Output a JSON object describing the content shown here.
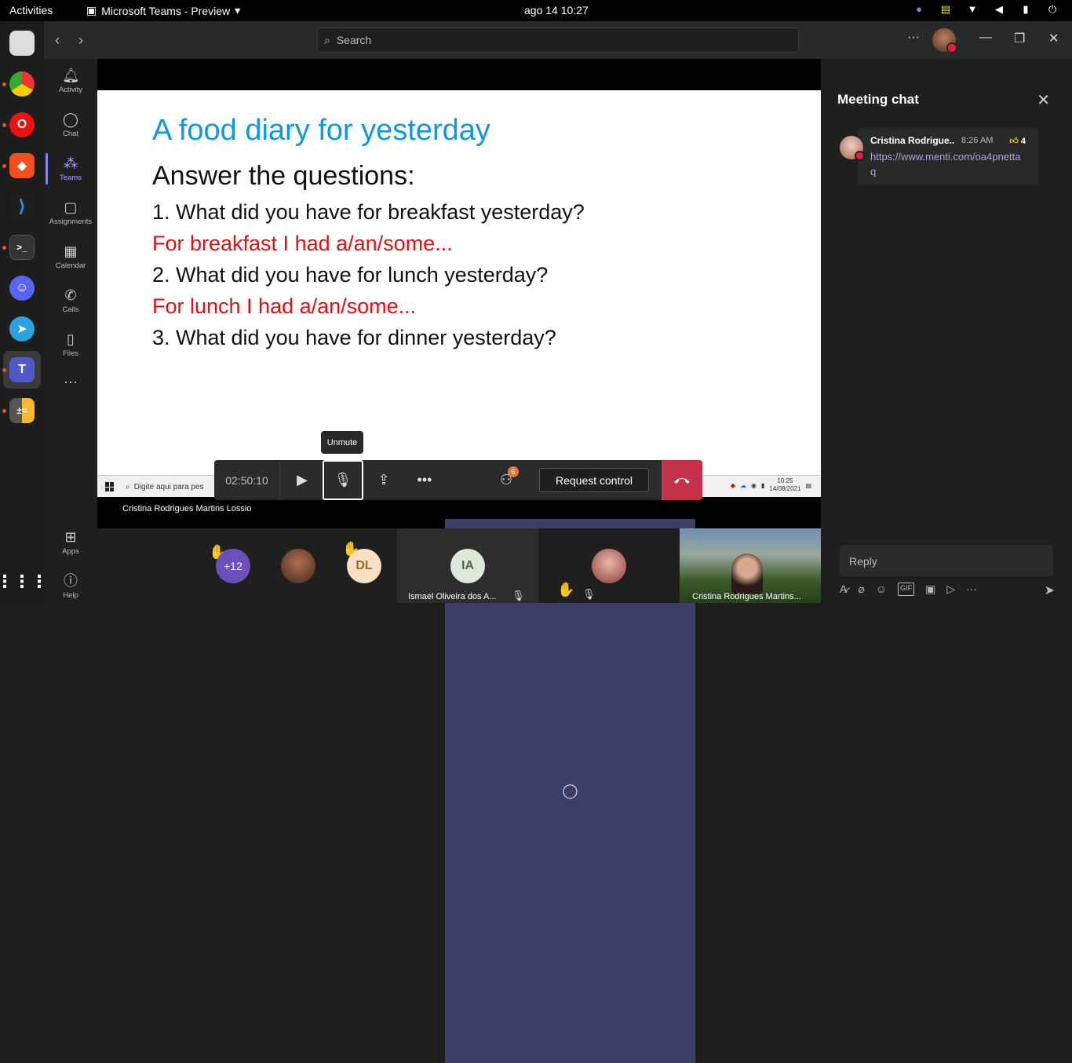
{
  "topbar": {
    "activities": "Activities",
    "app_name": "Microsoft Teams - Preview",
    "clock": "ago 14  10:27"
  },
  "teams": {
    "search_placeholder": "Search",
    "rail": [
      {
        "label": "Activity",
        "icon": "bell-icon"
      },
      {
        "label": "Chat",
        "icon": "chat-icon"
      },
      {
        "label": "Teams",
        "icon": "teams-icon"
      },
      {
        "label": "Assignments",
        "icon": "assignments-icon"
      },
      {
        "label": "Calendar",
        "icon": "calendar-icon"
      },
      {
        "label": "Calls",
        "icon": "phone-icon"
      },
      {
        "label": "Files",
        "icon": "file-icon"
      }
    ],
    "apps_label": "Apps",
    "help_label": "Help"
  },
  "slide": {
    "title": "A food diary for yesterday",
    "heading": "Answer the questions:",
    "q1": "1. What did you have for breakfast yesterday?",
    "a1": "For breakfast I had a/an/some...",
    "q2": "2. What did you have for lunch yesterday?",
    "a2": "For lunch I had a/an/some...",
    "q3": "3. What did you have for dinner yesterday?",
    "taskbar_search": "Digite aqui para pes",
    "taskbar_time": "10:25",
    "taskbar_date": "14/08/2021"
  },
  "presenter": "Cristina Rodrigues Martins Lossio",
  "controls": {
    "timer": "02:50:10",
    "tooltip": "Unmute",
    "participants_badge": "6",
    "request_control": "Request control"
  },
  "participants": {
    "overflow": "+12",
    "dl_initials": "DL",
    "ia_initials": "IA",
    "ia_name": "Ismael Oliveira dos A...",
    "cristina_name": "Cristina Rodrigues Martins..."
  },
  "chat": {
    "title": "Meeting chat",
    "message": {
      "author": "Cristina Rodrigue...",
      "time": "8:26 AM",
      "reaction_count": "4",
      "link": "https://www.menti.com/oa4pnettaq"
    },
    "reply_placeholder": "Reply"
  }
}
